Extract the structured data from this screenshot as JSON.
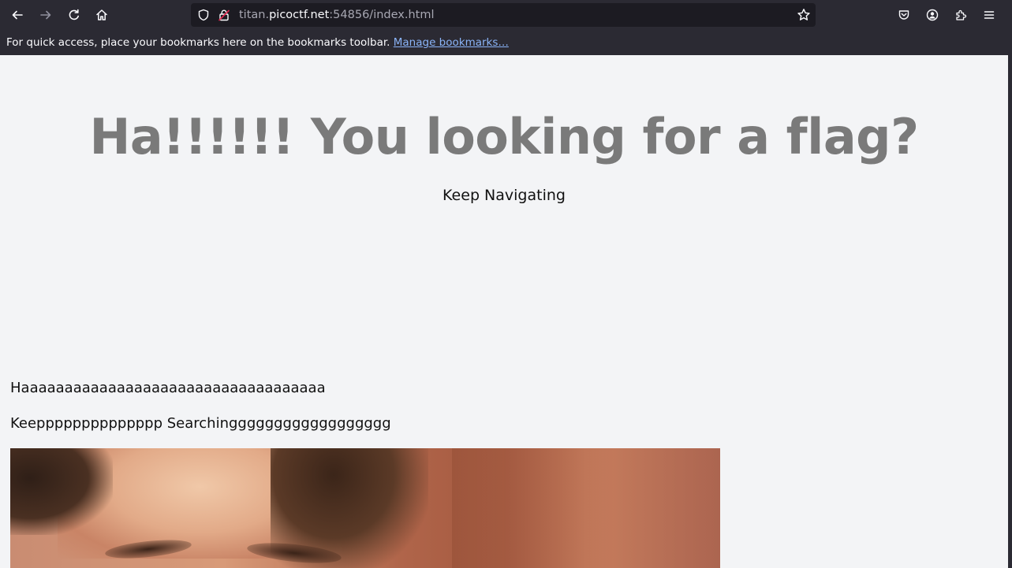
{
  "browser": {
    "url_prefix": "titan.",
    "url_domain": "picoctf.net",
    "url_suffix": ":54856/index.html",
    "bookmarks_message": "For quick access, place your bookmarks here on the bookmarks toolbar.",
    "manage_bookmarks_label": "Manage bookmarks…"
  },
  "page": {
    "headline": "Ha!!!!!! You looking for a flag?",
    "subheading": "Keep Navigating",
    "paragraph_1": "Haaaaaaaaaaaaaaaaaaaaaaaaaaaaaaaaaaa",
    "paragraph_2": "Keepppppppppppppp Searchingggggggggggggggggg"
  }
}
